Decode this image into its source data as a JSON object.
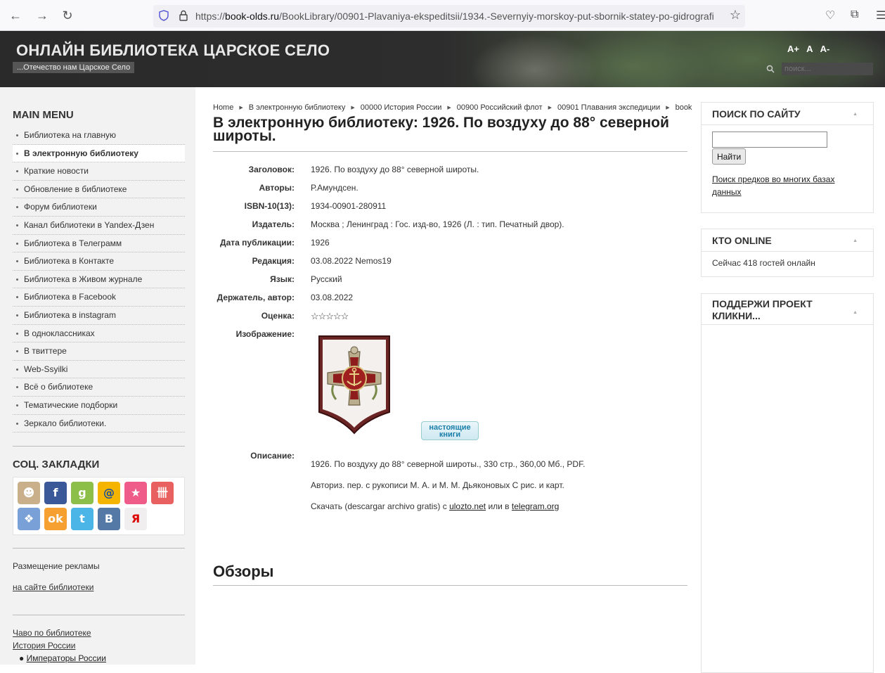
{
  "browser": {
    "url_prefix": "https://",
    "url_host": "book-olds.ru",
    "url_path": "/BookLibrary/00901-Plavaniya-ekspeditsii/1934.-Severnyiy-morskoy-put-sbornik-statey-po-gidrografi"
  },
  "header": {
    "title": "ОНЛАЙН БИБЛИОТЕКА ЦАРСКОЕ СЕЛО",
    "subtitle": "...Отечество нам Царское Село",
    "font_controls": [
      "A+",
      "A",
      "A-"
    ],
    "search_placeholder": "поиск..."
  },
  "left": {
    "menu_title": "MAIN MENU",
    "menu": [
      "Библиотека на главную",
      "В электронную библиотеку",
      "Краткие новости",
      "Обновление в библиотеке",
      "Форум библиотеки",
      "Канал библиотеки в Yandex-Дзен",
      "Библиотека в Телеграмм",
      "Библиотека в Контакте",
      "Библиотека в Живом журнале",
      "Библиотека в Facebook",
      "Библиотека в instagram",
      "В одноклассниках",
      "В твиттере",
      "Web-Ssyilki",
      "Всё о библиотеке",
      "Тематические подборки",
      "Зеркало библиотеки."
    ],
    "active_index": 1,
    "social_title": "СОЦ. ЗАКЛАДКИ",
    "social_icons": [
      "memori-icon",
      "facebook-icon",
      "google-icon",
      "mail-icon",
      "bobrdobr-icon",
      "liveinternet-icon",
      "moikrug-icon",
      "odnoklassniki-icon",
      "twitter-icon",
      "vkontakte-icon",
      "yandex-icon"
    ],
    "ads_title": "Размещение рекламы",
    "ads_link": "на сайте библиотеки",
    "faq_link": "Чаво по библиотеке",
    "history_link": "История России",
    "emperors_link": "Императоры России"
  },
  "main": {
    "breadcrumbs": [
      "Home",
      "В электронную библиотеку",
      "00000 История России",
      "00900 Российский флот",
      "00901 Плавания экспедиции",
      "book"
    ],
    "title": "В электронную библиотеку: 1926. По воздуху до 88° северной широты.",
    "fields": [
      {
        "label": "Заголовок:",
        "value": "1926. По воздуху до 88° северной широты."
      },
      {
        "label": "Авторы:",
        "value": "Р.Амундсен."
      },
      {
        "label": "ISBN-10(13):",
        "value": "1934-00901-280911"
      },
      {
        "label": "Издатель:",
        "value": "Москва ; Ленинград : Гос. изд-во, 1926 (Л. : тип. Печатный двор)."
      },
      {
        "label": "Дата публикации:",
        "value": "1926"
      },
      {
        "label": "Редакция:",
        "value": "03.08.2022 Nemos19"
      },
      {
        "label": "Язык:",
        "value": "Русский"
      },
      {
        "label": "Держатель, автор:",
        "value": "03.08.2022"
      }
    ],
    "rating_label": "Оценка:",
    "rating_stars": "☆☆☆☆☆",
    "image_label": "Изображение:",
    "badge_text": "настоящие книги",
    "description_label": "Описание:",
    "description_lines": [
      "1926. По воздуху до 88° северной широты., 330 стр., 360,00 Мб., PDF.",
      "Авториз. пер. с рукописи М. А. и М. М. Дьяконовых С рис. и карт."
    ],
    "download_prefix": "Скачать (descargar archivo gratis) с ",
    "download_link1": "ulozto.net",
    "download_mid": " или в ",
    "download_link2": "telegram.org",
    "reviews_title": "Обзоры"
  },
  "right": {
    "search_title": "ПОИСК ПО САЙТУ",
    "search_button": "Найти",
    "search_link": "Поиск предков во многих базах данных",
    "online_title": "КТО ONLINE",
    "online_text": "Сейчас 418 гостей онлайн",
    "support_title": "ПОДДЕРЖИ ПРОЕКТ КЛИКНИ..."
  }
}
